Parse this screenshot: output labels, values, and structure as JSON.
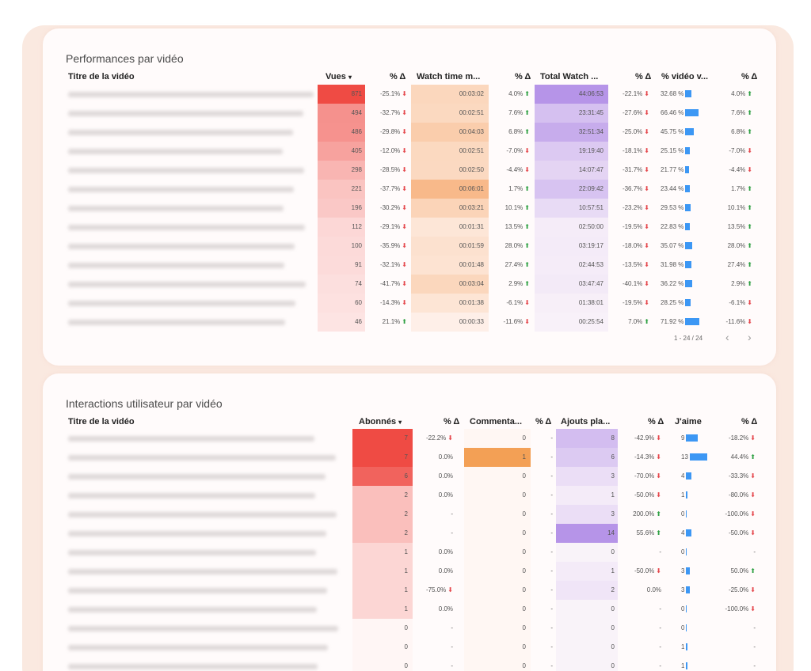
{
  "perf": {
    "title": "Performances par vidéo",
    "headers": {
      "title": "Titre de la vidéo",
      "views": "Vues",
      "views_sort": "▾",
      "pct1": "% Δ",
      "watch_time": "Watch time m...",
      "pct2": "% Δ",
      "total_watch": "Total Watch ...",
      "pct3": "% Δ",
      "pct_video": "% vidéo v...",
      "pct4": "% Δ"
    },
    "rows": [
      {
        "views": "871",
        "d1": "-25.1%",
        "d1dir": "down",
        "wt": "00:03:02",
        "d2": "4.0%",
        "d2dir": "up",
        "tw": "44:06:53",
        "d3": "-22.1%",
        "d3dir": "down",
        "pv": "32.68 %",
        "pvv": 32.68,
        "d4": "4.0%",
        "d4dir": "up"
      },
      {
        "views": "494",
        "d1": "-32.7%",
        "d1dir": "down",
        "wt": "00:02:51",
        "d2": "7.6%",
        "d2dir": "up",
        "tw": "23:31:45",
        "d3": "-27.6%",
        "d3dir": "down",
        "pv": "66.46 %",
        "pvv": 66.46,
        "d4": "7.6%",
        "d4dir": "up"
      },
      {
        "views": "486",
        "d1": "-29.8%",
        "d1dir": "down",
        "wt": "00:04:03",
        "d2": "6.8%",
        "d2dir": "up",
        "tw": "32:51:34",
        "d3": "-25.0%",
        "d3dir": "down",
        "pv": "45.75 %",
        "pvv": 45.75,
        "d4": "6.8%",
        "d4dir": "up"
      },
      {
        "views": "405",
        "d1": "-12.0%",
        "d1dir": "down",
        "wt": "00:02:51",
        "d2": "-7.0%",
        "d2dir": "down",
        "tw": "19:19:40",
        "d3": "-18.1%",
        "d3dir": "down",
        "pv": "25.15 %",
        "pvv": 25.15,
        "d4": "-7.0%",
        "d4dir": "down"
      },
      {
        "views": "298",
        "d1": "-28.5%",
        "d1dir": "down",
        "wt": "00:02:50",
        "d2": "-4.4%",
        "d2dir": "down",
        "tw": "14:07:47",
        "d3": "-31.7%",
        "d3dir": "down",
        "pv": "21.77 %",
        "pvv": 21.77,
        "d4": "-4.4%",
        "d4dir": "down"
      },
      {
        "views": "221",
        "d1": "-37.7%",
        "d1dir": "down",
        "wt": "00:06:01",
        "d2": "1.7%",
        "d2dir": "up",
        "tw": "22:09:42",
        "d3": "-36.7%",
        "d3dir": "down",
        "pv": "23.44 %",
        "pvv": 23.44,
        "d4": "1.7%",
        "d4dir": "up"
      },
      {
        "views": "196",
        "d1": "-30.2%",
        "d1dir": "down",
        "wt": "00:03:21",
        "d2": "10.1%",
        "d2dir": "up",
        "tw": "10:57:51",
        "d3": "-23.2%",
        "d3dir": "down",
        "pv": "29.53 %",
        "pvv": 29.53,
        "d4": "10.1%",
        "d4dir": "up"
      },
      {
        "views": "112",
        "d1": "-29.1%",
        "d1dir": "down",
        "wt": "00:01:31",
        "d2": "13.5%",
        "d2dir": "up",
        "tw": "02:50:00",
        "d3": "-19.5%",
        "d3dir": "down",
        "pv": "22.83 %",
        "pvv": 22.83,
        "d4": "13.5%",
        "d4dir": "up"
      },
      {
        "views": "100",
        "d1": "-35.9%",
        "d1dir": "down",
        "wt": "00:01:59",
        "d2": "28.0%",
        "d2dir": "up",
        "tw": "03:19:17",
        "d3": "-18.0%",
        "d3dir": "down",
        "pv": "35.07 %",
        "pvv": 35.07,
        "d4": "28.0%",
        "d4dir": "up"
      },
      {
        "views": "91",
        "d1": "-32.1%",
        "d1dir": "down",
        "wt": "00:01:48",
        "d2": "27.4%",
        "d2dir": "up",
        "tw": "02:44:53",
        "d3": "-13.5%",
        "d3dir": "down",
        "pv": "31.98 %",
        "pvv": 31.98,
        "d4": "27.4%",
        "d4dir": "up"
      },
      {
        "views": "74",
        "d1": "-41.7%",
        "d1dir": "down",
        "wt": "00:03:04",
        "d2": "2.9%",
        "d2dir": "up",
        "tw": "03:47:47",
        "d3": "-40.1%",
        "d3dir": "down",
        "pv": "36.22 %",
        "pvv": 36.22,
        "d4": "2.9%",
        "d4dir": "up"
      },
      {
        "views": "60",
        "d1": "-14.3%",
        "d1dir": "down",
        "wt": "00:01:38",
        "d2": "-6.1%",
        "d2dir": "down",
        "tw": "01:38:01",
        "d3": "-19.5%",
        "d3dir": "down",
        "pv": "28.25 %",
        "pvv": 28.25,
        "d4": "-6.1%",
        "d4dir": "down"
      },
      {
        "views": "46",
        "d1": "21.1%",
        "d1dir": "up",
        "wt": "00:00:33",
        "d2": "-11.6%",
        "d2dir": "down",
        "tw": "00:25:54",
        "d3": "7.0%",
        "d3dir": "up",
        "pv": "71.92 %",
        "pvv": 71.92,
        "d4": "-11.6%",
        "d4dir": "down"
      }
    ],
    "pager": "1 - 24 / 24",
    "prev": "‹",
    "next": "›"
  },
  "inter": {
    "title": "Interactions utilisateur par vidéo",
    "headers": {
      "title": "Titre de la vidéo",
      "subs": "Abonnés",
      "subs_sort": "▾",
      "pct1": "% Δ",
      "comments": "Commenta...",
      "pct2": "% Δ",
      "playlist": "Ajouts pla...",
      "pct3": "% Δ",
      "likes": "J'aime",
      "pct4": "% Δ"
    },
    "rows": [
      {
        "subs": "7",
        "d1": "-22.2%",
        "d1dir": "down",
        "com": "0",
        "d2": "-",
        "pl": "8",
        "d3": "-42.9%",
        "d3dir": "down",
        "lk": "9",
        "d4": "-18.2%",
        "d4dir": "down"
      },
      {
        "subs": "7",
        "d1": "0.0%",
        "d1dir": "",
        "com": "1",
        "d2": "-",
        "pl": "6",
        "d3": "-14.3%",
        "d3dir": "down",
        "lk": "13",
        "d4": "44.4%",
        "d4dir": "up"
      },
      {
        "subs": "6",
        "d1": "0.0%",
        "d1dir": "",
        "com": "0",
        "d2": "-",
        "pl": "3",
        "d3": "-70.0%",
        "d3dir": "down",
        "lk": "4",
        "d4": "-33.3%",
        "d4dir": "down"
      },
      {
        "subs": "2",
        "d1": "0.0%",
        "d1dir": "",
        "com": "0",
        "d2": "-",
        "pl": "1",
        "d3": "-50.0%",
        "d3dir": "down",
        "lk": "1",
        "d4": "-80.0%",
        "d4dir": "down"
      },
      {
        "subs": "2",
        "d1": "-",
        "d1dir": "",
        "com": "0",
        "d2": "-",
        "pl": "3",
        "d3": "200.0%",
        "d3dir": "up",
        "lk": "0",
        "d4": "-100.0%",
        "d4dir": "down"
      },
      {
        "subs": "2",
        "d1": "-",
        "d1dir": "",
        "com": "0",
        "d2": "-",
        "pl": "14",
        "d3": "55.6%",
        "d3dir": "up",
        "lk": "4",
        "d4": "-50.0%",
        "d4dir": "down"
      },
      {
        "subs": "1",
        "d1": "0.0%",
        "d1dir": "",
        "com": "0",
        "d2": "-",
        "pl": "0",
        "d3": "-",
        "d3dir": "",
        "lk": "0",
        "d4": "-",
        "d4dir": ""
      },
      {
        "subs": "1",
        "d1": "0.0%",
        "d1dir": "",
        "com": "0",
        "d2": "-",
        "pl": "1",
        "d3": "-50.0%",
        "d3dir": "down",
        "lk": "3",
        "d4": "50.0%",
        "d4dir": "up"
      },
      {
        "subs": "1",
        "d1": "-75.0%",
        "d1dir": "down",
        "com": "0",
        "d2": "-",
        "pl": "2",
        "d3": "0.0%",
        "d3dir": "",
        "lk": "3",
        "d4": "-25.0%",
        "d4dir": "down"
      },
      {
        "subs": "1",
        "d1": "0.0%",
        "d1dir": "",
        "com": "0",
        "d2": "-",
        "pl": "0",
        "d3": "-",
        "d3dir": "",
        "lk": "0",
        "d4": "-100.0%",
        "d4dir": "down"
      },
      {
        "subs": "0",
        "d1": "-",
        "d1dir": "",
        "com": "0",
        "d2": "-",
        "pl": "0",
        "d3": "-",
        "d3dir": "",
        "lk": "0",
        "d4": "-",
        "d4dir": ""
      },
      {
        "subs": "0",
        "d1": "-",
        "d1dir": "",
        "com": "0",
        "d2": "-",
        "pl": "0",
        "d3": "-",
        "d3dir": "",
        "lk": "1",
        "d4": "-",
        "d4dir": ""
      },
      {
        "subs": "0",
        "d1": "-",
        "d1dir": "",
        "com": "0",
        "d2": "-",
        "pl": "0",
        "d3": "-",
        "d3dir": "",
        "lk": "1",
        "d4": "-",
        "d4dir": ""
      }
    ]
  },
  "colors": {
    "views_heat": "#ef4b44",
    "watch_heat": "#f8b98a",
    "total_heat": "#b694e8",
    "bar_blue": "#3c97f4",
    "comment_heat": "#f3a055",
    "up": "#2ea043",
    "down": "#e5484d"
  }
}
